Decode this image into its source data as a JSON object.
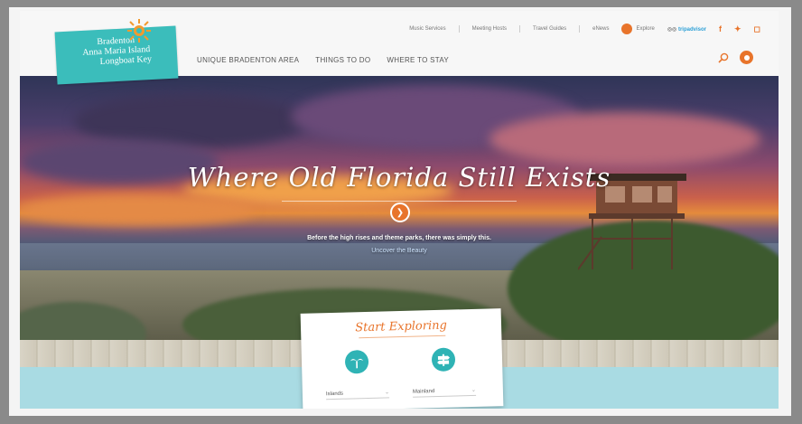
{
  "logo": {
    "line1": "Bradenton",
    "line2": "Anna Maria Island",
    "line3": "Longboat Key"
  },
  "topbar": {
    "links": [
      "Music Services",
      "Meeting Hosts",
      "Travel Guides",
      "eNews"
    ],
    "explore_label": "Explore",
    "tripadvisor_prefix": "tripadvisor",
    "social": [
      "f",
      "t",
      "ig"
    ]
  },
  "mainnav": {
    "items": [
      "UNIQUE BRADENTON AREA",
      "THINGS TO DO",
      "WHERE TO STAY"
    ]
  },
  "hero": {
    "title": "Where Old Florida Still Exists",
    "subtitle": "Before the high rises and theme parks, there was simply this.",
    "link": "Uncover the Beauty"
  },
  "explore": {
    "title": "Start Exploring",
    "select1_value": "Islands",
    "select2_value": "Mainland"
  },
  "colors": {
    "accent": "#e8742b",
    "teal": "#3bbdbb",
    "band": "#a9dbe3"
  }
}
